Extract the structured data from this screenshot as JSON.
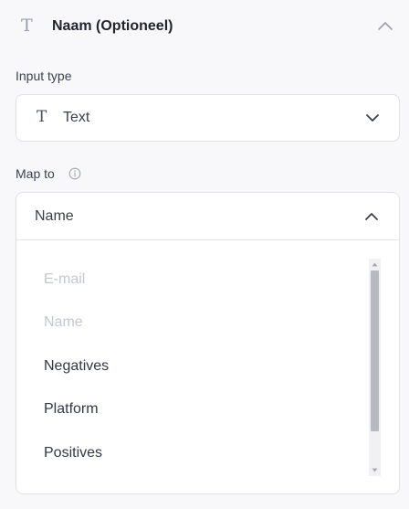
{
  "section": {
    "icon": "text-type-icon",
    "title": "Naam (Optioneel)",
    "collapse_icon": "chevron-up-icon"
  },
  "input_type": {
    "label": "Input type",
    "value": "Text",
    "value_icon": "text-type-icon",
    "dropdown_icon": "chevron-down-icon"
  },
  "map_to": {
    "label": "Map to",
    "info_icon": "info-icon",
    "value": "Name",
    "dropdown_icon": "chevron-up-icon",
    "options": [
      {
        "label": "E-mail",
        "disabled": true
      },
      {
        "label": "Name",
        "disabled": true
      },
      {
        "label": "Negatives",
        "disabled": false
      },
      {
        "label": "Platform",
        "disabled": false
      },
      {
        "label": "Positives",
        "disabled": false
      }
    ]
  },
  "colors": {
    "background": "#f8f8fb",
    "border": "#dfe1e7",
    "text_primary": "#1f2430",
    "text_disabled": "#c4c7cf",
    "icon_muted": "#9aa0ad"
  }
}
